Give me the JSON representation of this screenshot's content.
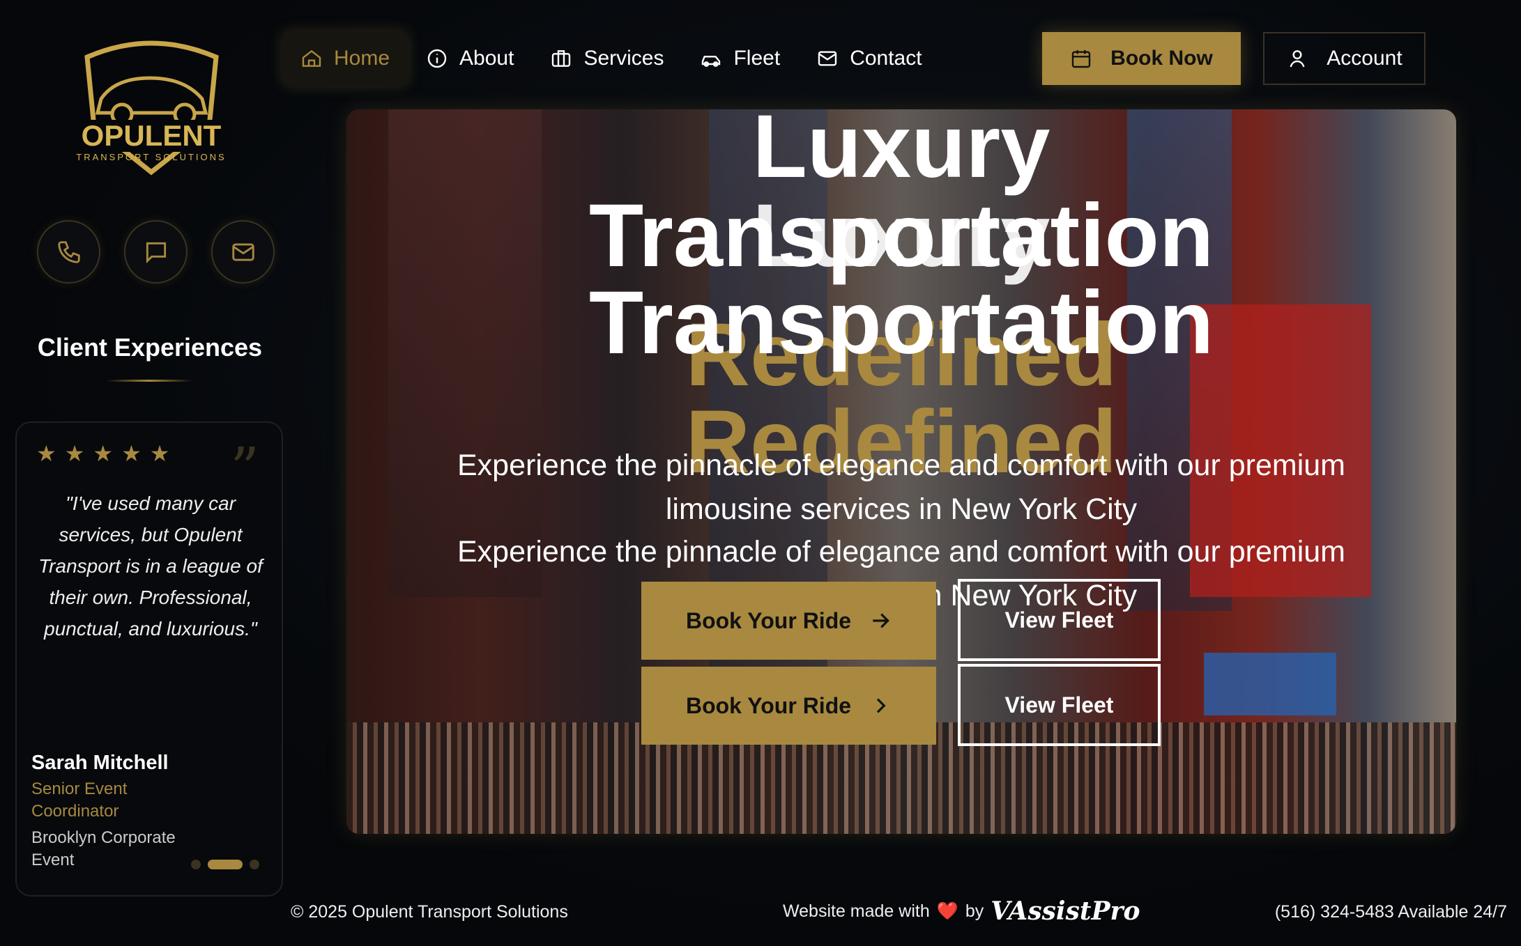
{
  "logo": {
    "name": "OPULENT",
    "tagline": "TRANSPORT SOLUTIONS"
  },
  "nav": {
    "items": [
      {
        "label": "Home",
        "icon": "home-icon",
        "active": true
      },
      {
        "label": "About",
        "icon": "info-icon"
      },
      {
        "label": "Services",
        "icon": "briefcase-icon"
      },
      {
        "label": "Fleet",
        "icon": "car-icon"
      },
      {
        "label": "Contact",
        "icon": "mail-icon"
      }
    ],
    "book_now": "Book Now",
    "account": "Account"
  },
  "sidebar": {
    "contact_icons": [
      "phone-icon",
      "chat-icon",
      "mail-icon"
    ],
    "section_title": "Client Experiences",
    "review": {
      "stars": 5,
      "text": "\"I've used many car services, but Opulent Transport is in a league of their own. Professional, punctual, and luxurious.\"",
      "name": "Sarah Mitchell",
      "role": "Senior Event Coordinator",
      "event": "Brooklyn Corporate Event",
      "active_slide": 2,
      "slide_count": 3
    }
  },
  "hero": {
    "title_line1": "Luxury",
    "title_line2": "Transportation",
    "title_line3": "Redefined",
    "subtitle": "Experience the pinnacle of elegance and comfort with our premium limousine services in New York City",
    "book_ride": "Book Your Ride",
    "view_fleet": "View Fleet"
  },
  "footer": {
    "copyright": "© 2025 Opulent Transport Solutions",
    "made_with": "Website made with",
    "heart": "❤️",
    "by": "by",
    "brand": "VAssistPro",
    "phone": "(516) 324-5483 Available 24/7"
  },
  "colors": {
    "accent": "#a8893f",
    "background": "#05070a"
  }
}
